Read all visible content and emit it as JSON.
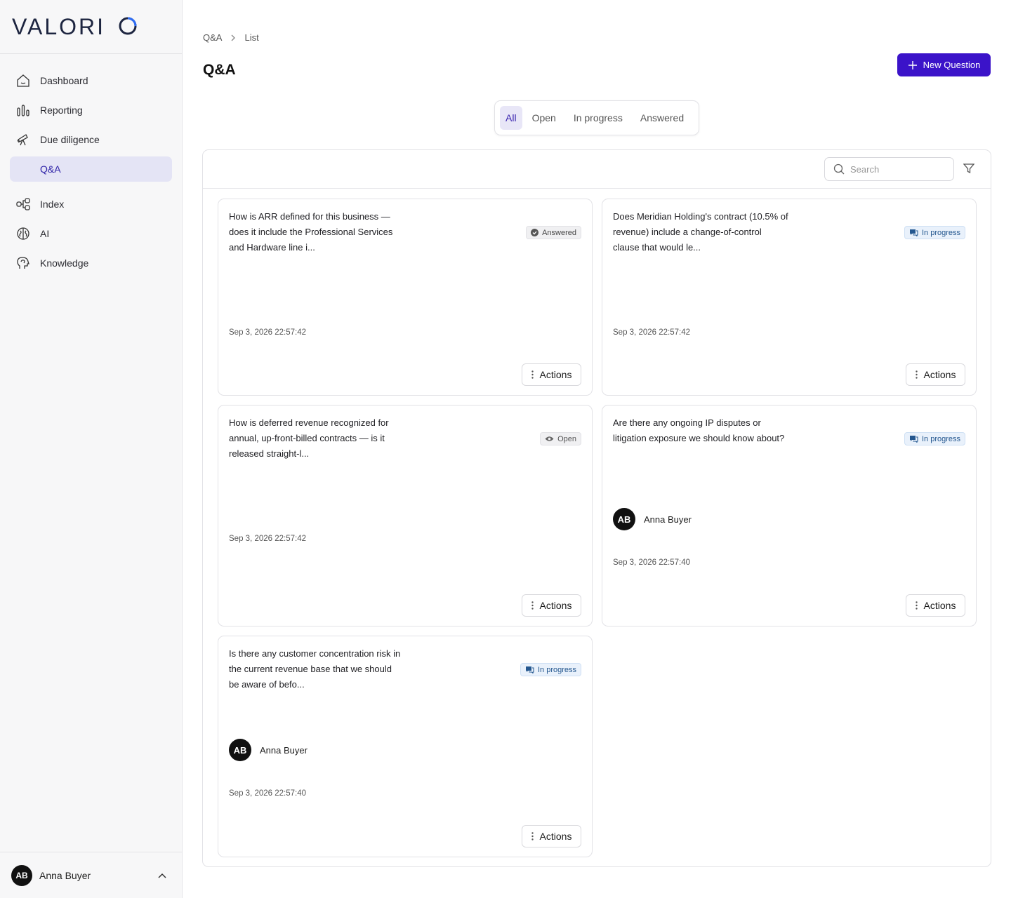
{
  "brand": {
    "logo_text": "VALORIO"
  },
  "sidebar": {
    "items": [
      {
        "label": "Dashboard",
        "icon": "home-icon"
      },
      {
        "label": "Reporting",
        "icon": "bar-chart-icon"
      },
      {
        "label": "Due diligence",
        "icon": "telescope-icon"
      },
      {
        "label": "Q&A",
        "icon": "",
        "active": true
      },
      {
        "label": "Index",
        "icon": "index-tree-icon"
      },
      {
        "label": "AI",
        "icon": "brain-icon"
      },
      {
        "label": "Knowledge",
        "icon": "head-icon"
      }
    ],
    "user": {
      "initials": "AB",
      "name": "Anna Buyer"
    }
  },
  "breadcrumb": {
    "root": "Q&A",
    "current": "List"
  },
  "page": {
    "title": "Q&A",
    "new_button": "New Question"
  },
  "tabs": [
    {
      "label": "All",
      "active": true
    },
    {
      "label": "Open"
    },
    {
      "label": "In progress"
    },
    {
      "label": "Answered"
    }
  ],
  "search": {
    "placeholder": "Search"
  },
  "cards": [
    {
      "question": "How is ARR defined for this business — does it include the Professional Services and Hardware line i...",
      "status": "Answered",
      "date": "Sep 3, 2026 22:57:42",
      "actions": "Actions"
    },
    {
      "question": "Does Meridian Holding's contract (10.5% of revenue) include a change-of-control clause that would le...",
      "status": "In progress",
      "date": "Sep 3, 2026 22:57:42",
      "actions": "Actions"
    },
    {
      "question": "How is deferred revenue recognized for annual, up-front-billed contracts — is it released straight-l...",
      "status": "Open",
      "date": "Sep 3, 2026 22:57:42",
      "actions": "Actions"
    },
    {
      "question": "Are there any ongoing IP disputes or litigation exposure we should know about?",
      "status": "In progress",
      "assignee": {
        "initials": "AB",
        "name": "Anna Buyer"
      },
      "date": "Sep 3, 2026 22:57:40",
      "actions": "Actions"
    },
    {
      "question": "Is there any customer concentration risk in the current revenue base that we should be aware of befo...",
      "status": "In progress",
      "assignee": {
        "initials": "AB",
        "name": "Anna Buyer"
      },
      "date": "Sep 3, 2026 22:57:40",
      "actions": "Actions"
    }
  ],
  "colors": {
    "primary": "#3b13c9",
    "active_nav_bg": "#e4e4f5",
    "progress_badge": "#24578f"
  }
}
